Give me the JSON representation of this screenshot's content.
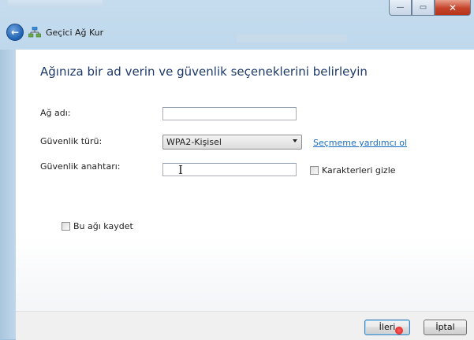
{
  "window": {
    "title": "Geçici Ağ Kur",
    "controls": {
      "minimize": "—",
      "maximize": "▭",
      "close": "✕"
    }
  },
  "heading": "Ağınıza bir ad verin ve güvenlik seçeneklerini belirleyin",
  "form": {
    "network_name_label": "Ağ adı:",
    "network_name_value": "",
    "security_type_label": "Güvenlik türü:",
    "security_type_value": "WPA2-Kişisel",
    "help_link": "Seçmeme yardımcı ol",
    "security_key_label": "Güvenlik anahtarı:",
    "security_key_value": "",
    "hide_chars_label": "Karakterleri gizle",
    "hide_chars_checked": false,
    "save_network_label": "Bu ağı kaydet",
    "save_network_checked": false
  },
  "buttons": {
    "next": "İleri",
    "cancel": "İptal"
  },
  "colors": {
    "heading": "#1e3a6b",
    "link": "#1a6ec1",
    "close_button": "#c6432b",
    "frame": "#b7d1e8"
  },
  "icons": {
    "back": "back-arrow-icon",
    "network": "network-icon",
    "cursor": "text-cursor-icon"
  }
}
